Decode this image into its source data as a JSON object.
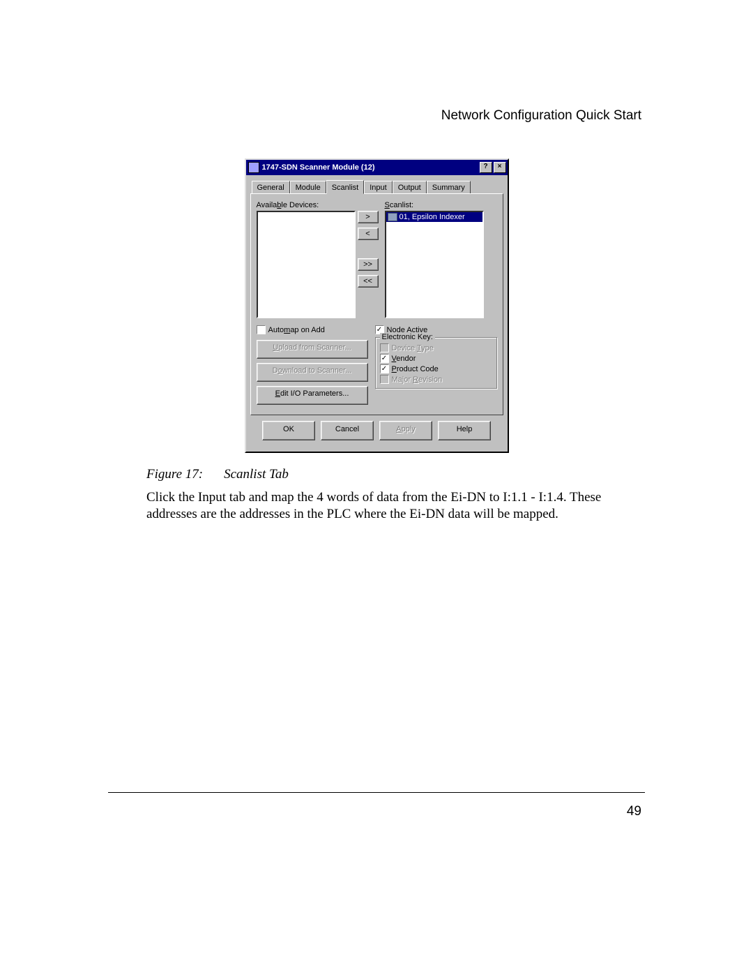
{
  "header": {
    "section_title": "Network Configuration Quick Start"
  },
  "dialog": {
    "title": "1747-SDN Scanner Module (12)",
    "help_btn": "?",
    "close_btn": "×",
    "tabs": {
      "general": "General",
      "module": "Module",
      "scanlist": "Scanlist",
      "input": "Input",
      "output": "Output",
      "summary": "Summary"
    },
    "available_label_pre": "Availa",
    "available_label_u": "b",
    "available_label_post": "le Devices:",
    "scanlist_label_u": "S",
    "scanlist_label_post": "canlist:",
    "scanlist_item": "01, Epsilon Indexer",
    "arrows": {
      "add": ">",
      "remove": "<",
      "add_all": ">>",
      "remove_all": "<<"
    },
    "automap_pre": "Auto",
    "automap_u": "m",
    "automap_post": "ap on Add",
    "upload_btn_u": "U",
    "upload_btn_post": "pload from Scanner...",
    "download_btn_pre": "D",
    "download_btn_u": "o",
    "download_btn_post": "wnload to Scanner...",
    "edit_btn_u": "E",
    "edit_btn_post": "dit I/O Parameters...",
    "node_active_u": "N",
    "node_active_post": "ode Active",
    "electronic_key": "Electronic Key:",
    "device_type_pre": "Device ",
    "device_type_u": "T",
    "device_type_post": "ype",
    "vendor_u": "V",
    "vendor_post": "endor",
    "product_code_u": "P",
    "product_code_post": "roduct Code",
    "major_rev_pre": "Major ",
    "major_rev_u": "R",
    "major_rev_post": "evision",
    "ok": "OK",
    "cancel": "Cancel",
    "apply_u": "A",
    "apply_post": "pply",
    "help": "Help"
  },
  "caption": {
    "prefix": "Figure 17:",
    "text": "Scanlist Tab"
  },
  "body": "Click the Input tab and map the 4 words of data from the Ei-DN to I:1.1 - I:1.4. These addresses are the addresses in the PLC where the Ei-DN data will be mapped.",
  "page_number": "49"
}
